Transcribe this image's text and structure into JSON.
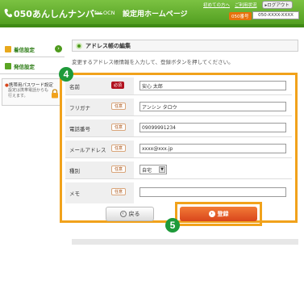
{
  "header": {
    "brand": "050あんしんナンバー",
    "brand_sub": "for OCN",
    "page_name": "設定用ホームページ",
    "link_first_time": "初めての方へ",
    "link_contract": "ご利用状況",
    "logout_label": "ログアウト",
    "number_badge": "050番号",
    "number_value": "050-XXXX-XXXX"
  },
  "sidebar": {
    "items": [
      {
        "label": "着信設定"
      },
      {
        "label": "発信設定"
      }
    ],
    "password_box": {
      "title": "携帯用パスワード設定",
      "text": "設定は携帯電話からも行えます。"
    }
  },
  "main": {
    "section_title": "アドレス帳の編集",
    "instruction": "変更するアドレス帳情報を入力して、登録ボタンを押してください。",
    "required_label": "必須",
    "optional_label": "任意",
    "fields": [
      {
        "label": "名前",
        "value": "安心 太郎",
        "required": true
      },
      {
        "label": "フリガナ",
        "value": "アンシン タロウ",
        "required": false
      },
      {
        "label": "電話番号",
        "value": "09099991234",
        "required": false
      },
      {
        "label": "メールアドレス",
        "value": "xxxx@xxx.jp",
        "required": false
      },
      {
        "label": "種別",
        "value": "自宅",
        "required": false
      },
      {
        "label": "メモ",
        "value": "",
        "required": false
      }
    ],
    "back_button": "戻る",
    "register_button": "登録",
    "step4": "4",
    "step5": "5"
  },
  "colors": {
    "header_green": "#5aa524",
    "highlight_orange": "#f1a21b",
    "step_green": "#1e9a3a",
    "required_red": "#b2121f",
    "register_orange": "#e55a25"
  }
}
